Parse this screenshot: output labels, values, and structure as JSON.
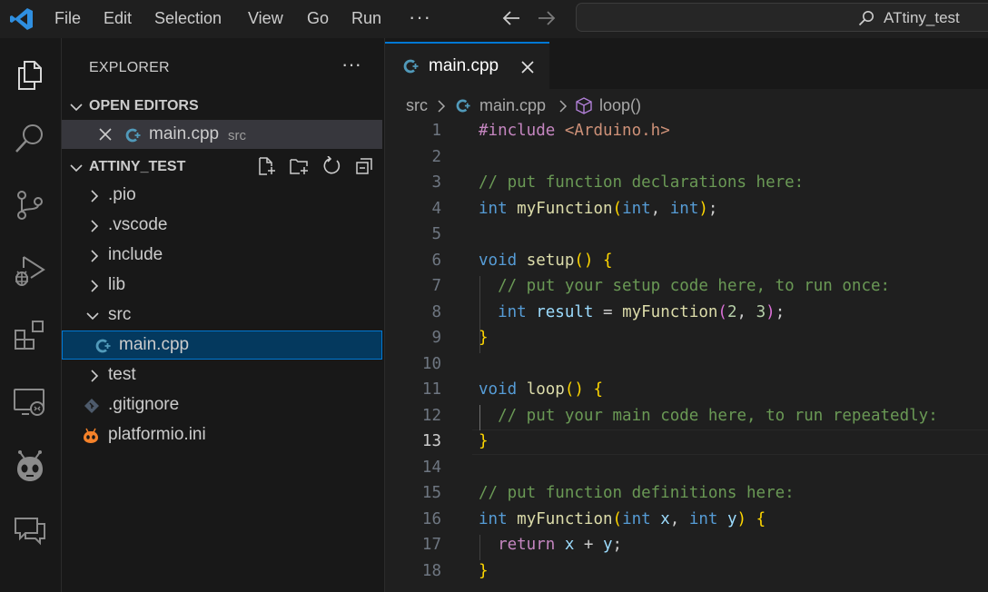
{
  "titlebar": {
    "menu": [
      "File",
      "Edit",
      "Selection",
      "View",
      "Go",
      "Run"
    ],
    "more": "···",
    "command_center": "ATtiny_test"
  },
  "activity_bar": {
    "items": [
      "explorer-icon",
      "search-icon",
      "source-control-icon",
      "run-debug-icon",
      "extensions-icon",
      "remote-explorer-icon",
      "platformio-icon",
      "chat-icon"
    ]
  },
  "sidebar": {
    "title": "EXPLORER",
    "more": "···",
    "open_editors": {
      "header": "OPEN EDITORS",
      "items": [
        {
          "name": "main.cpp",
          "description": "src"
        }
      ]
    },
    "project": {
      "header": "ATTINY_TEST",
      "tree": [
        {
          "label": ".pio",
          "type": "folder",
          "expanded": false
        },
        {
          "label": ".vscode",
          "type": "folder",
          "expanded": false
        },
        {
          "label": "include",
          "type": "folder",
          "expanded": false
        },
        {
          "label": "lib",
          "type": "folder",
          "expanded": false
        },
        {
          "label": "src",
          "type": "folder",
          "expanded": true
        },
        {
          "label": "main.cpp",
          "type": "cpp-file",
          "selected": true
        },
        {
          "label": "test",
          "type": "folder",
          "expanded": false
        },
        {
          "label": ".gitignore",
          "type": "git-file"
        },
        {
          "label": "platformio.ini",
          "type": "platformio-file"
        }
      ]
    }
  },
  "editor": {
    "tab": {
      "label": "main.cpp"
    },
    "breadcrumb": {
      "folder": "src",
      "file": "main.cpp",
      "symbol": "loop()"
    },
    "active_line": 13,
    "lines": [
      [
        [
          "ctl",
          "#include"
        ],
        [
          "",
          " "
        ],
        [
          "str",
          "<Arduino.h>"
        ]
      ],
      [],
      [
        [
          "cm",
          "// put function declarations here:"
        ]
      ],
      [
        [
          "kw",
          "int"
        ],
        [
          "",
          " "
        ],
        [
          "fn",
          "myFunction"
        ],
        [
          "br1",
          "("
        ],
        [
          "kw",
          "int"
        ],
        [
          "",
          ", "
        ],
        [
          "kw",
          "int"
        ],
        [
          "br1",
          ")"
        ],
        [
          "",
          ";"
        ]
      ],
      [],
      [
        [
          "kw",
          "void"
        ],
        [
          "",
          " "
        ],
        [
          "fn",
          "setup"
        ],
        [
          "br1",
          "()"
        ],
        [
          "",
          " "
        ],
        [
          "br1",
          "{"
        ]
      ],
      [
        [
          "",
          "  "
        ],
        [
          "cm",
          "// put your setup code here, to run once:"
        ]
      ],
      [
        [
          "",
          "  "
        ],
        [
          "kw",
          "int"
        ],
        [
          "",
          " "
        ],
        [
          "var",
          "result"
        ],
        [
          "",
          ""
        ],
        [
          "",
          " = "
        ],
        [
          "fn",
          "myFunction"
        ],
        [
          "br2",
          "("
        ],
        [
          "num",
          "2"
        ],
        [
          "",
          ", "
        ],
        [
          "num",
          "3"
        ],
        [
          "br2",
          ")"
        ],
        [
          "",
          ";"
        ]
      ],
      [
        [
          "br1",
          "}"
        ]
      ],
      [],
      [
        [
          "kw",
          "void"
        ],
        [
          "",
          " "
        ],
        [
          "fn",
          "loop"
        ],
        [
          "br1",
          "()"
        ],
        [
          "",
          " "
        ],
        [
          "br1",
          "{"
        ]
      ],
      [
        [
          "",
          "  "
        ],
        [
          "cm",
          "// put your main code here, to run repeatedly:"
        ]
      ],
      [
        [
          "br1",
          "}"
        ]
      ],
      [],
      [
        [
          "cm",
          "// put function definitions here:"
        ]
      ],
      [
        [
          "kw",
          "int"
        ],
        [
          "",
          " "
        ],
        [
          "fn",
          "myFunction"
        ],
        [
          "br1",
          "("
        ],
        [
          "kw",
          "int"
        ],
        [
          "",
          " "
        ],
        [
          "var",
          "x"
        ],
        [
          "",
          ", "
        ],
        [
          "kw",
          "int"
        ],
        [
          "",
          " "
        ],
        [
          "var",
          "y"
        ],
        [
          "br1",
          ")"
        ],
        [
          "",
          " "
        ],
        [
          "br1",
          "{"
        ]
      ],
      [
        [
          "",
          "  "
        ],
        [
          "ctl",
          "return"
        ],
        [
          "",
          " "
        ],
        [
          "var",
          "x"
        ],
        [
          "",
          " + "
        ],
        [
          "var",
          "y"
        ],
        [
          "",
          ";"
        ]
      ],
      [
        [
          "br1",
          "}"
        ]
      ]
    ]
  },
  "colors": {
    "accent": "#0078d4",
    "selection": "#04395e",
    "cpp_icon": "#519aba",
    "platformio_icon": "#f5822a"
  }
}
